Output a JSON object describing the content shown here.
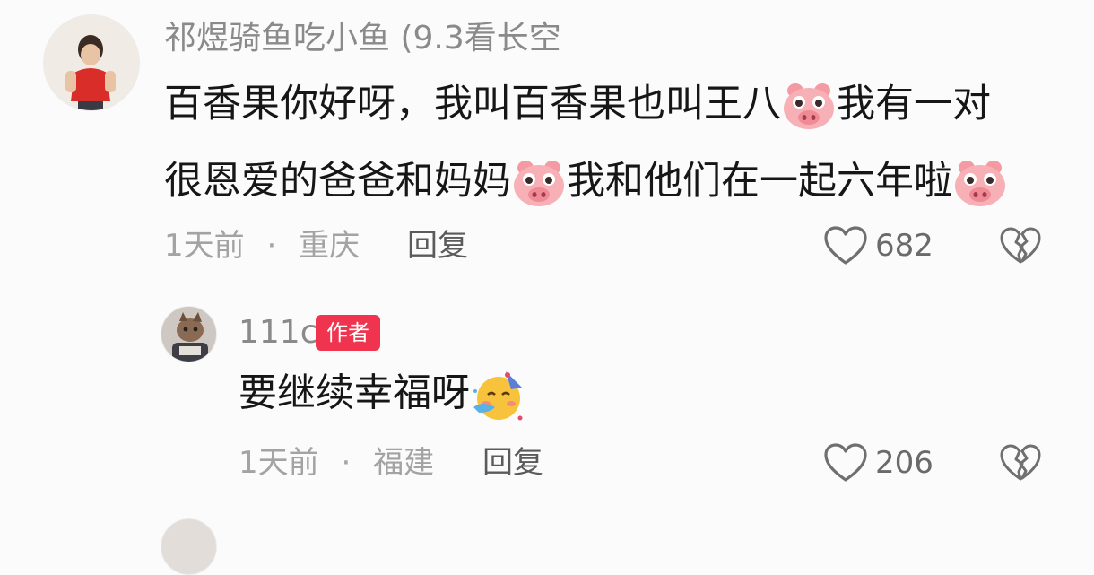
{
  "comments": [
    {
      "username": "祁煜骑鱼吃小鱼 (9.3看长空",
      "text_line1_a": "百香果你好呀，我叫百香果也叫王八",
      "text_line1_b": "我有一对",
      "text_line2_a": "很恩爱的爸爸和妈妈",
      "text_line2_b": "我和他们在一起六年啦",
      "emoji": "pig-face",
      "time": "1天前",
      "dot": "·",
      "location": "重庆",
      "reply_label": "回复",
      "likes": "682"
    }
  ],
  "reply": {
    "username": "111c",
    "badge": "作者",
    "text": "要继续幸福呀",
    "emoji": "partying-face",
    "time": "1天前",
    "dot": "·",
    "location": "福建",
    "reply_label": "回复",
    "likes": "206"
  },
  "icons": {
    "like": "heart-outline-icon",
    "dislike": "broken-heart-icon"
  },
  "colors": {
    "background": "#fbfbfb",
    "badge": "#f0344f",
    "pig": "#f6a3a8",
    "meta_text": "#a3a3a3"
  }
}
